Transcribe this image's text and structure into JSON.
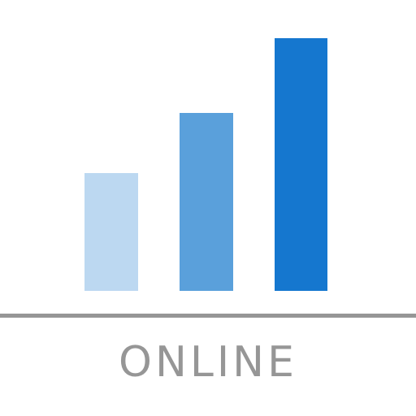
{
  "label": "ONLINE",
  "level": {
    "active": 3,
    "total": 3
  },
  "colors": {
    "bar_light": "#bcd8f1",
    "bar_medium": "#5aa0db",
    "bar_dark": "#1577cf",
    "baseline": "#969696",
    "label": "#969696",
    "background": "#ffffff"
  },
  "icon": "signal-bars-icon"
}
